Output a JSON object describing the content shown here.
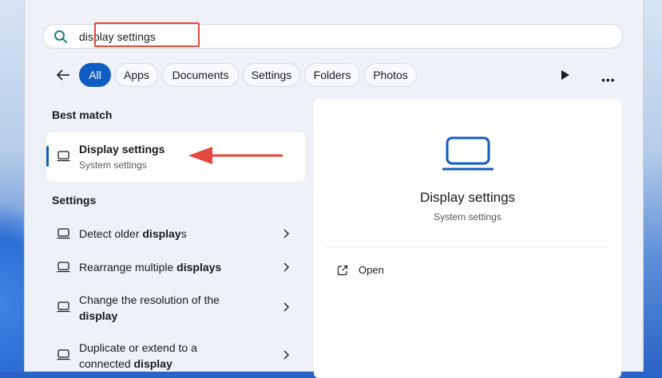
{
  "search": {
    "value": "display settings"
  },
  "filters": [
    "All",
    "Apps",
    "Documents",
    "Settings",
    "Folders",
    "Photos"
  ],
  "more_label": "•••",
  "best_match": {
    "heading": "Best match",
    "title": "Display settings",
    "subtitle": "System settings"
  },
  "settings": {
    "heading": "Settings",
    "items": [
      {
        "text_pre": "Detect older ",
        "text_bold": "display",
        "text_post": "s",
        "line2": ""
      },
      {
        "text_pre": "Rearrange multiple ",
        "text_bold": "displays",
        "text_post": "",
        "line2": ""
      },
      {
        "text_pre": "Change the resolution of the",
        "text_bold": "display",
        "text_post": "",
        "line2": "yes"
      },
      {
        "text_pre": "Duplicate or extend to a connected",
        "text_bold": "display",
        "text_post": "",
        "line2": "yes"
      }
    ]
  },
  "preview": {
    "title": "Display settings",
    "subtitle": "System settings",
    "open_label": "Open"
  },
  "colors": {
    "accent": "#0f5cc2",
    "highlight": "#e5483e"
  }
}
